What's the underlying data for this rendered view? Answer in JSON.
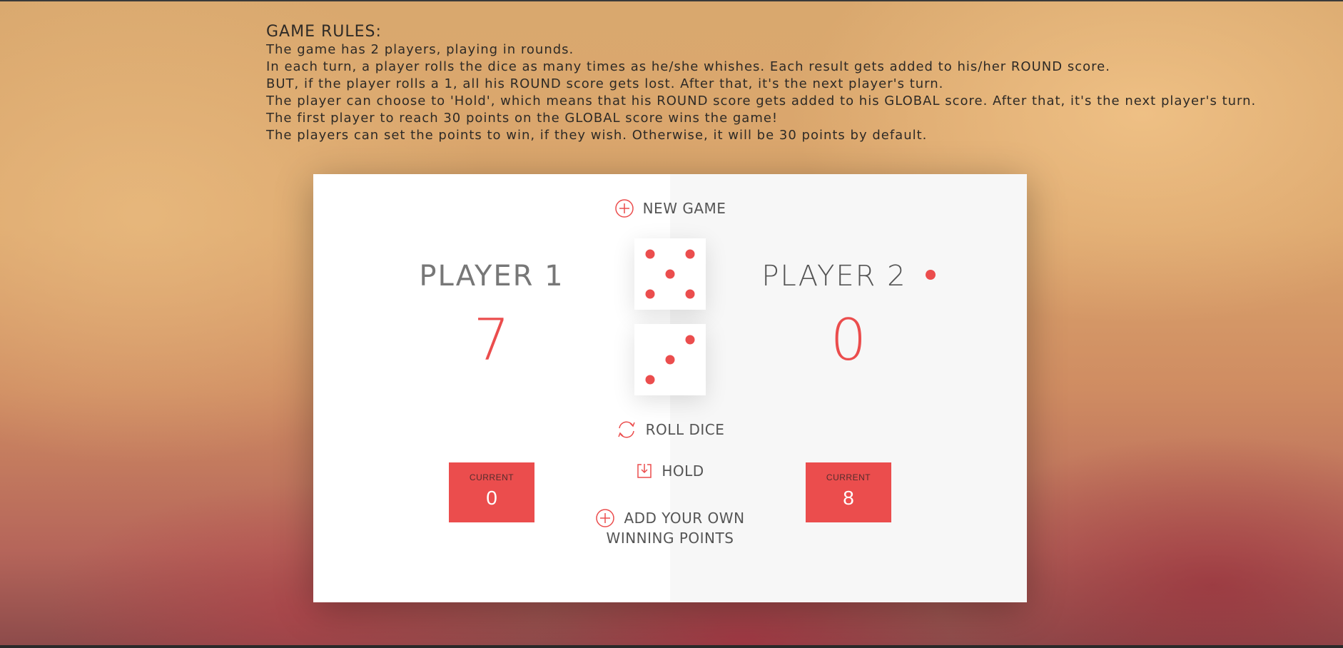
{
  "rules": {
    "title": "GAME RULES:",
    "lines": [
      "The game has 2 players, playing in rounds.",
      "In each turn, a player rolls the dice as many times as he/she whishes. Each result gets added to his/her ROUND score.",
      "BUT, if the player rolls a 1, all his ROUND score gets lost. After that, it's the next player's turn.",
      "The player can choose to 'Hold', which means that his ROUND score gets added to his GLOBAL score. After that, it's the next player's turn.",
      "The first player to reach 30 points on the GLOBAL score wins the game!",
      "The players can set the points to win, if they wish. Otherwise, it will be 30 points by default."
    ]
  },
  "buttons": {
    "new_game": "NEW GAME",
    "roll_dice": "ROLL DICE",
    "hold": "HOLD",
    "add_points_line1": "ADD YOUR OWN",
    "add_points_line2": "WINNING POINTS"
  },
  "players": [
    {
      "name": "PLAYER 1",
      "score": "7",
      "current_label": "CURRENT",
      "current": "0",
      "active": false
    },
    {
      "name": "PLAYER 2",
      "score": "0",
      "current_label": "CURRENT",
      "current": "8",
      "active": true
    }
  ],
  "dice": [
    5,
    3
  ],
  "colors": {
    "accent": "#eb4d4d",
    "panel": "#ffffff",
    "panel_alt": "#f7f7f7"
  },
  "icons": [
    "plus-circle-icon",
    "refresh-icon",
    "download-icon"
  ]
}
